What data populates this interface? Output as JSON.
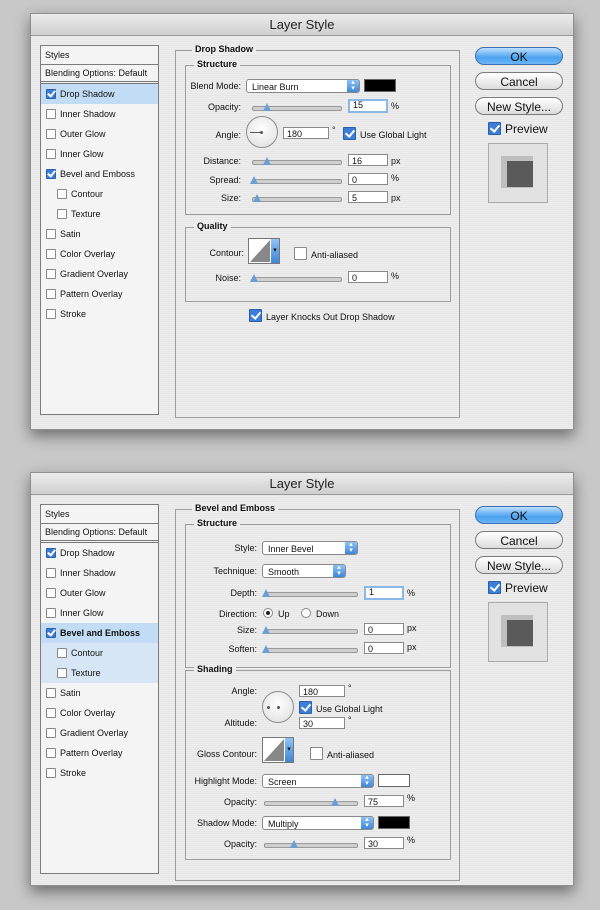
{
  "dialog1": {
    "title": "Layer Style",
    "styles_header": "Styles",
    "blending_options": "Blending Options: Default",
    "style_items": [
      {
        "label": "Drop Shadow",
        "checked": true
      },
      {
        "label": "Inner Shadow",
        "checked": false
      },
      {
        "label": "Outer Glow",
        "checked": false
      },
      {
        "label": "Inner Glow",
        "checked": false
      },
      {
        "label": "Bevel and Emboss",
        "checked": true
      },
      {
        "label": "Contour",
        "checked": false
      },
      {
        "label": "Texture",
        "checked": false
      },
      {
        "label": "Satin",
        "checked": false
      },
      {
        "label": "Color Overlay",
        "checked": false
      },
      {
        "label": "Gradient Overlay",
        "checked": false
      },
      {
        "label": "Pattern Overlay",
        "checked": false
      },
      {
        "label": "Stroke",
        "checked": false
      }
    ],
    "panel_title": "Drop Shadow",
    "structure": {
      "title": "Structure",
      "blend_mode_label": "Blend Mode:",
      "blend_mode_value": "Linear Burn",
      "blend_color": "#000000",
      "opacity_label": "Opacity:",
      "opacity_value": "15",
      "opacity_unit": "%",
      "angle_label": "Angle:",
      "angle_value": "180",
      "angle_unit": "°",
      "global_light_label": "Use Global Light",
      "distance_label": "Distance:",
      "distance_value": "16",
      "distance_unit": "px",
      "spread_label": "Spread:",
      "spread_value": "0",
      "spread_unit": "%",
      "size_label": "Size:",
      "size_value": "5",
      "size_unit": "px"
    },
    "quality": {
      "title": "Quality",
      "contour_label": "Contour:",
      "anti_aliased_label": "Anti-aliased",
      "noise_label": "Noise:",
      "noise_value": "0",
      "noise_unit": "%"
    },
    "knockout_label": "Layer Knocks Out Drop Shadow",
    "buttons": {
      "ok": "OK",
      "cancel": "Cancel",
      "new_style": "New Style...",
      "preview": "Preview"
    }
  },
  "dialog2": {
    "title": "Layer Style",
    "styles_header": "Styles",
    "blending_options": "Blending Options: Default",
    "style_items": [
      {
        "label": "Drop Shadow",
        "checked": true
      },
      {
        "label": "Inner Shadow",
        "checked": false
      },
      {
        "label": "Outer Glow",
        "checked": false
      },
      {
        "label": "Inner Glow",
        "checked": false
      },
      {
        "label": "Bevel and Emboss",
        "checked": true
      },
      {
        "label": "Contour",
        "checked": false
      },
      {
        "label": "Texture",
        "checked": false
      },
      {
        "label": "Satin",
        "checked": false
      },
      {
        "label": "Color Overlay",
        "checked": false
      },
      {
        "label": "Gradient Overlay",
        "checked": false
      },
      {
        "label": "Pattern Overlay",
        "checked": false
      },
      {
        "label": "Stroke",
        "checked": false
      }
    ],
    "panel_title": "Bevel and Emboss",
    "structure": {
      "title": "Structure",
      "style_label": "Style:",
      "style_value": "Inner Bevel",
      "technique_label": "Technique:",
      "technique_value": "Smooth",
      "depth_label": "Depth:",
      "depth_value": "1",
      "depth_unit": "%",
      "direction_label": "Direction:",
      "direction_up": "Up",
      "direction_down": "Down",
      "size_label": "Size:",
      "size_value": "0",
      "size_unit": "px",
      "soften_label": "Soften:",
      "soften_value": "0",
      "soften_unit": "px"
    },
    "shading": {
      "title": "Shading",
      "angle_label": "Angle:",
      "angle_value": "180",
      "angle_unit": "°",
      "global_light_label": "Use Global Light",
      "altitude_label": "Altitude:",
      "altitude_value": "30",
      "altitude_unit": "°",
      "gloss_contour_label": "Gloss Contour:",
      "anti_aliased_label": "Anti-aliased",
      "highlight_mode_label": "Highlight Mode:",
      "highlight_mode_value": "Screen",
      "highlight_color": "#ffffff",
      "highlight_opacity_label": "Opacity:",
      "highlight_opacity_value": "75",
      "highlight_opacity_unit": "%",
      "shadow_mode_label": "Shadow Mode:",
      "shadow_mode_value": "Multiply",
      "shadow_color": "#000000",
      "shadow_opacity_label": "Opacity:",
      "shadow_opacity_value": "30",
      "shadow_opacity_unit": "%"
    },
    "buttons": {
      "ok": "OK",
      "cancel": "Cancel",
      "new_style": "New Style...",
      "preview": "Preview"
    }
  }
}
